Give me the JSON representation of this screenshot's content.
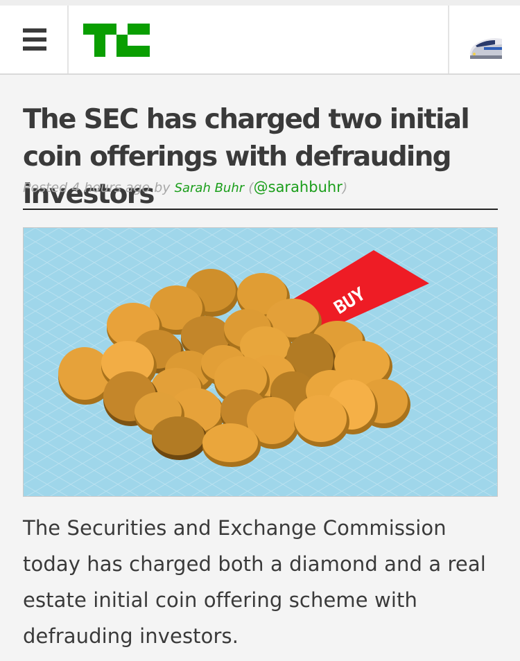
{
  "header": {
    "menu_icon": "hamburger-menu-icon",
    "logo_icon": "techcrunch-logo",
    "logo_color": "#0a9e01",
    "right_icon": "bullet-train-emoji-icon"
  },
  "article": {
    "title": "The SEC has charged two initial coin offerings with defrauding investors",
    "byline": {
      "posted": "Posted",
      "time": "4 hours ago",
      "by": "by",
      "author": "Sarah Buhr",
      "open_paren": "(",
      "handle": "@sarahbuhr",
      "close_paren": ")"
    },
    "image": {
      "icon": "coin-pile-illustration",
      "tag_text": "BUY",
      "tag_color": "#ee1c25",
      "background_color": "#9fd6ea"
    },
    "body": "The Securities and Exchange Commission today has charged both a diamond and a real estate initial coin offering scheme with defrauding investors."
  }
}
